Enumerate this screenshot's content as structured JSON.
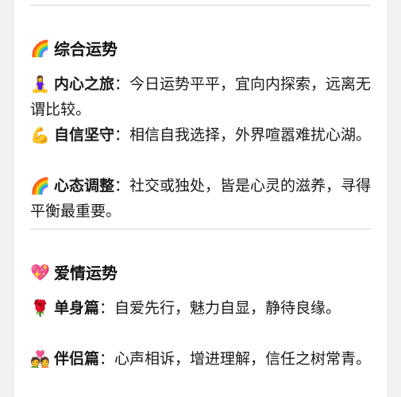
{
  "sections": [
    {
      "title": "综合运势",
      "icon": "rainbow-icon",
      "items": [
        {
          "icon": "meditation-icon",
          "label": "内心之旅",
          "text": "：今日运势平平，宜向内探索，远离无谓比较。"
        },
        {
          "icon": "flexed-biceps-icon",
          "label": "自信坚守",
          "text": "：相信自我选择，外界喧嚣难扰心湖。"
        },
        {
          "icon": "rainbow-icon",
          "label": "心态调整",
          "text": "：社交或独处，皆是心灵的滋养，寻得平衡最重要。"
        }
      ]
    },
    {
      "title": "爱情运势",
      "icon": "sparkling-heart-icon",
      "items": [
        {
          "icon": "rose-icon",
          "label": "单身篇",
          "text": "：自爱先行，魅力自显，静待良缘。"
        },
        {
          "icon": "couple-heart-icon",
          "label": "伴侣篇",
          "text": "：心声相诉，增进理解，信任之树常青。"
        }
      ]
    }
  ]
}
